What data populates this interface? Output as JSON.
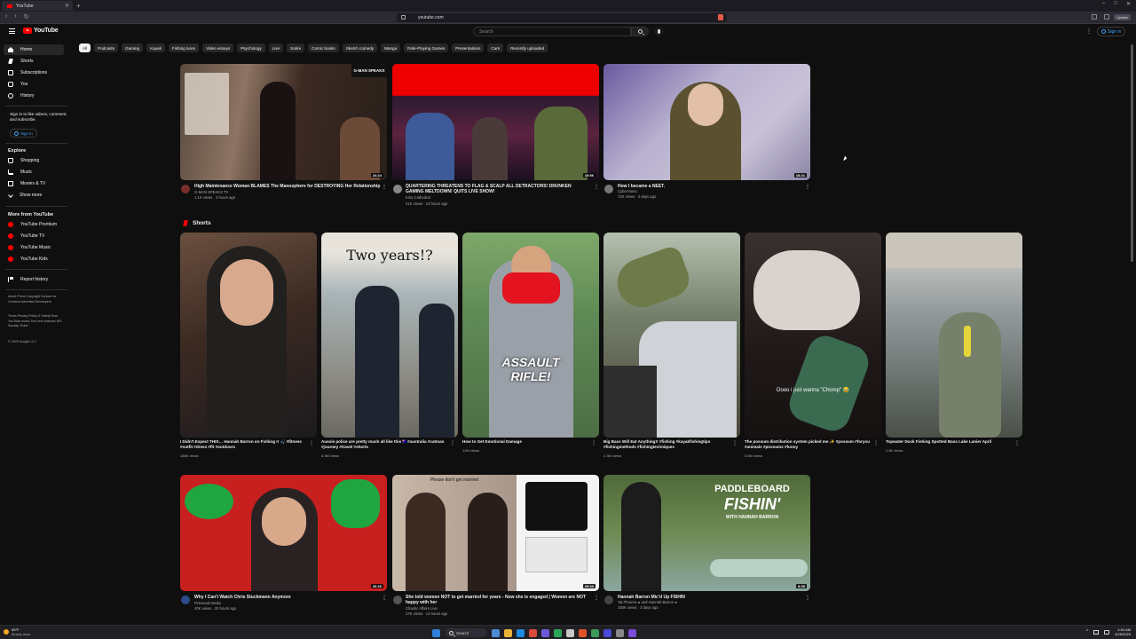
{
  "browser": {
    "tab_title": "YouTube",
    "url": "youtube.com",
    "update_label": "Update",
    "new_tab": "+",
    "window_controls": [
      "–",
      "□",
      "✕"
    ]
  },
  "header": {
    "logo_text": "YouTube",
    "search_placeholder": "Search",
    "signin_label": "Sign in",
    "kebab": "⋮"
  },
  "sidebar": {
    "main": [
      {
        "label": "Home",
        "icon": "home-icon"
      },
      {
        "label": "Shorts",
        "icon": "shorts-icon"
      },
      {
        "label": "Subscriptions",
        "icon": "subscriptions-icon"
      },
      {
        "label": "You",
        "icon": "you-icon"
      },
      {
        "label": "History",
        "icon": "history-icon"
      }
    ],
    "signin_prompt": "Sign in to like videos, comment, and subscribe.",
    "signin_button": "Sign in",
    "explore_heading": "Explore",
    "explore": [
      {
        "label": "Shopping",
        "icon": "shopping-bag-icon"
      },
      {
        "label": "Music",
        "icon": "music-note-icon"
      },
      {
        "label": "Movies & TV",
        "icon": "film-icon"
      },
      {
        "label": "Show more",
        "icon": "chevron-down-icon"
      }
    ],
    "more_heading": "More from YouTube",
    "more": [
      {
        "label": "YouTube Premium"
      },
      {
        "label": "YouTube TV"
      },
      {
        "label": "YouTube Music"
      },
      {
        "label": "YouTube Kids"
      }
    ],
    "report": "Report history",
    "footer1": "About  Press  Copyright  Contact us  Creators  Advertise  Developers",
    "footer2": "Terms  Privacy  Policy & Safety  How YouTube works  Test new features  NFL Sunday Ticket",
    "copyright": "© 2025 Google LLC"
  },
  "chips": [
    "All",
    "Podcasts",
    "Gaming",
    "Kayak",
    "Fishing lures",
    "Video essays",
    "Psychology",
    "Live",
    "Satire",
    "Comic books",
    "Sketch comedy",
    "Manga",
    "Role-Playing Games",
    "Presentations",
    "Cars",
    "Recently uploaded"
  ],
  "videos_top": [
    {
      "title": "High Maintenance Woman BLAMES The Manosphere for DESTROYING Her Relationship",
      "channel": "G-MAN SPEAKS TV",
      "meta": "1.1K views · 4 hours ago",
      "duration": "24:24",
      "badge": "G-MAN SPEAKS"
    },
    {
      "title": "QUARTERING THREATENS TO FLAG & SCALP ALL DETRACTORS! DRUNKEN GAMING MELTDOWN! QUITS LIVE SHOW!",
      "channel": "Kino Cathedral",
      "meta": "21K views · 13 hours ago",
      "duration": "18:56"
    },
    {
      "title": "How I became a NEET.",
      "channel": "CyberYamu",
      "meta": "73K views · 3 days ago",
      "duration": "18:21"
    }
  ],
  "shorts": {
    "heading": "Shorts",
    "items": [
      {
        "title": "I Didn't Expect THIS… Hannah Barron on Fishing !! 🎣 #fitness #outfit #dress #fit #outdoors",
        "views": "188K views"
      },
      {
        "title": "Aussie police are pretty much all like this 🇦🇺#australia #catman #journey #travel #shorts",
        "views": "6.3M views",
        "overlay": "Two years!?"
      },
      {
        "title": "How to Get Emotional Damage",
        "views": "12M views",
        "overlay": "ASSAULT RIFLE!"
      },
      {
        "title": "Big Bass Will Eat Anything!! #fishing #kayakfishingtips #fishingmethods #fishingtechniques",
        "views": "2.3M views"
      },
      {
        "title": "The possum distribution system picked me ✨ #possum #foryou #animals #possums #funny",
        "views": "5.6M views",
        "overlay": "Oooo i just wanna \"Chomp\" 😂"
      },
      {
        "title": "Topwater Dock Fishing Spotted Bass Lake Lanier April",
        "views": "2.5K views"
      }
    ]
  },
  "videos_bottom": [
    {
      "title": "Why I Can't Watch Chris Stuckmann Anymore",
      "channel": "Firewood Media",
      "meta": "40K views · 20 hours ago",
      "duration": "26:26"
    },
    {
      "title": "She told women NOT to get married for years - Now she is engaged | Women are NOT happy with her",
      "channel": "Chaotic Affairs Live",
      "meta": "27K views · 13 hours ago",
      "duration": "29:30",
      "overlay": "Please don't get married"
    },
    {
      "title": "Hannah Barron Mic'd Up FISHIN",
      "channel": "Tal Phoenix ● and Hannah Barron ●",
      "meta": "150K views · 3 days ago",
      "duration": "8:35",
      "overlay1": "PADDLEBOARD",
      "overlay2": "FISHIN'",
      "overlay3": "WITH HANNAH BARRON"
    }
  ],
  "taskbar": {
    "weather_temp": "55°F",
    "weather_desc": "Mostly clear",
    "search_label": "Search",
    "time": "4:53 AM",
    "date": "4/25/2025"
  },
  "colors": {
    "background": "#0f0f0f",
    "accent": "#ff0000",
    "link": "#3ea6ff"
  }
}
